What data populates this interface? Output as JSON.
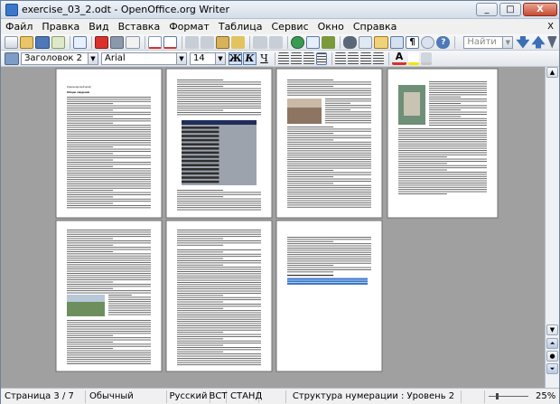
{
  "window": {
    "title": "exercise_03_2.odt - OpenOffice.org Writer",
    "minimize": "_",
    "maximize": "□",
    "close": "X"
  },
  "menu": {
    "items": [
      "Файл",
      "Правка",
      "Вид",
      "Вставка",
      "Формат",
      "Таблица",
      "Сервис",
      "Окно",
      "Справка"
    ],
    "close": "X"
  },
  "toolbar": {
    "find_placeholder": "Найти"
  },
  "format": {
    "style": "Заголовок 2",
    "font": "Arial",
    "size": "14",
    "bold": "Ж",
    "italic": "К",
    "underline": "Ч"
  },
  "pages": [
    {
      "heading": "Красноярский край",
      "subheading": "Общие сведения"
    },
    {},
    {
      "heading": "Природа и климат"
    },
    {},
    {
      "heading": "Заповедники и парки"
    },
    {
      "heading": "Культура и образование"
    },
    {
      "heading": "Население и занятость"
    }
  ],
  "status": {
    "page": "Страница  3 / 7",
    "style": "Обычный",
    "lang": "Русский",
    "ins": "ВСТ",
    "std": "СТАНД",
    "outline": "Структура нумерации : Уровень 2",
    "zoom": "25%"
  },
  "colors": {
    "accent": "#3b78c9",
    "table_header": "#1f2d5c",
    "table_band": "#9da3ad"
  }
}
